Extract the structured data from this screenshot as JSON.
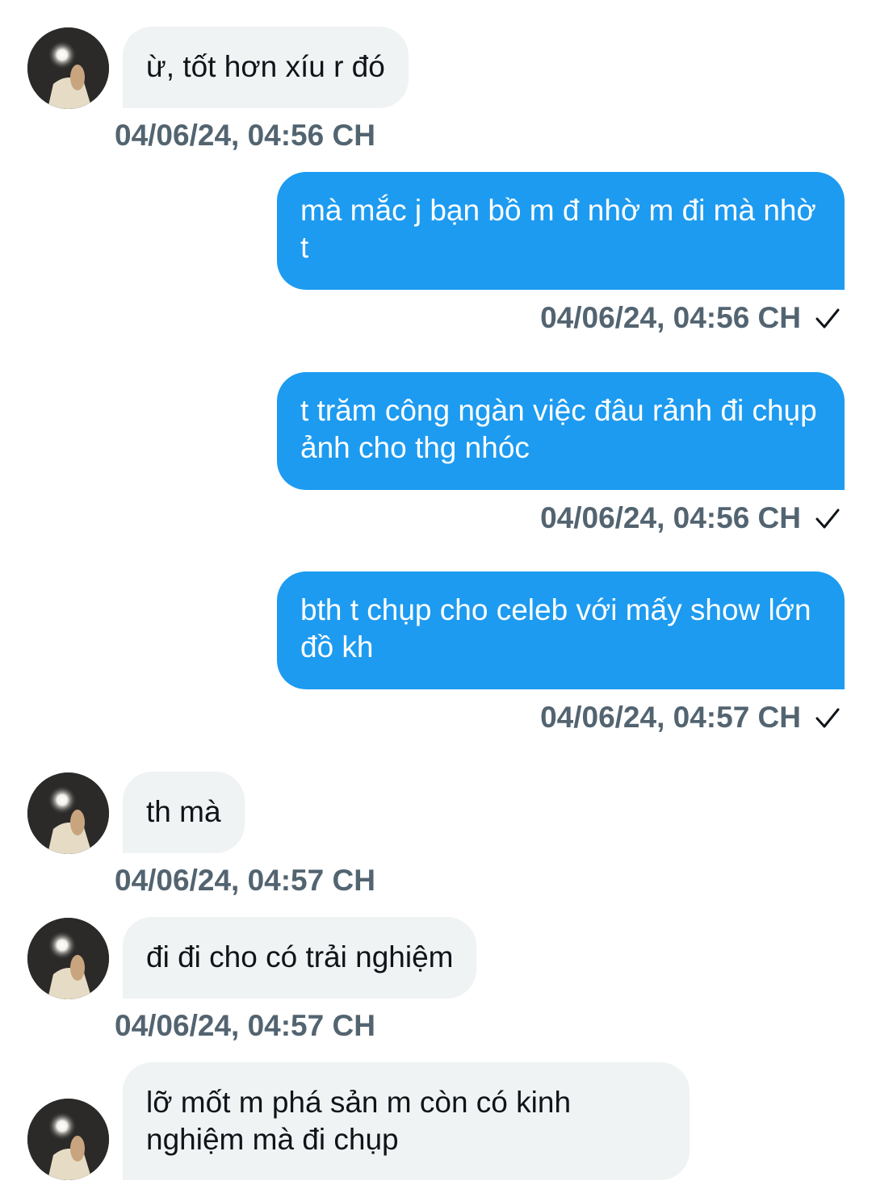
{
  "messages": [
    {
      "direction": "in",
      "text": "ừ, tốt hơn xíu r đó",
      "timestamp": "04/06/24, 04:56 CH"
    },
    {
      "direction": "out",
      "text": "mà mắc j bạn bồ m đ nhờ m đi mà nhờ t",
      "timestamp": "04/06/24, 04:56 CH",
      "status_icon": "checkmark-icon"
    },
    {
      "direction": "out",
      "text": "t trăm công ngàn việc đâu rảnh đi chụp ảnh cho thg nhóc",
      "timestamp": "04/06/24, 04:56 CH",
      "status_icon": "checkmark-icon"
    },
    {
      "direction": "out",
      "text": "bth t chụp cho celeb với mấy show lớn đồ kh",
      "timestamp": "04/06/24, 04:57 CH",
      "status_icon": "checkmark-icon"
    },
    {
      "direction": "in",
      "text": "th mà",
      "timestamp": "04/06/24, 04:57 CH"
    },
    {
      "direction": "in",
      "text": "đi đi cho có trải nghiệm",
      "timestamp": "04/06/24, 04:57 CH"
    },
    {
      "direction": "in",
      "text": "lỡ mốt m phá sản m còn có kinh nghiệm mà đi chụp",
      "timestamp": ""
    }
  ],
  "colors": {
    "outgoing_bubble": "#1d9bf0",
    "incoming_bubble": "#eff3f4",
    "timestamp": "#536471",
    "text_dark": "#0f1419"
  }
}
